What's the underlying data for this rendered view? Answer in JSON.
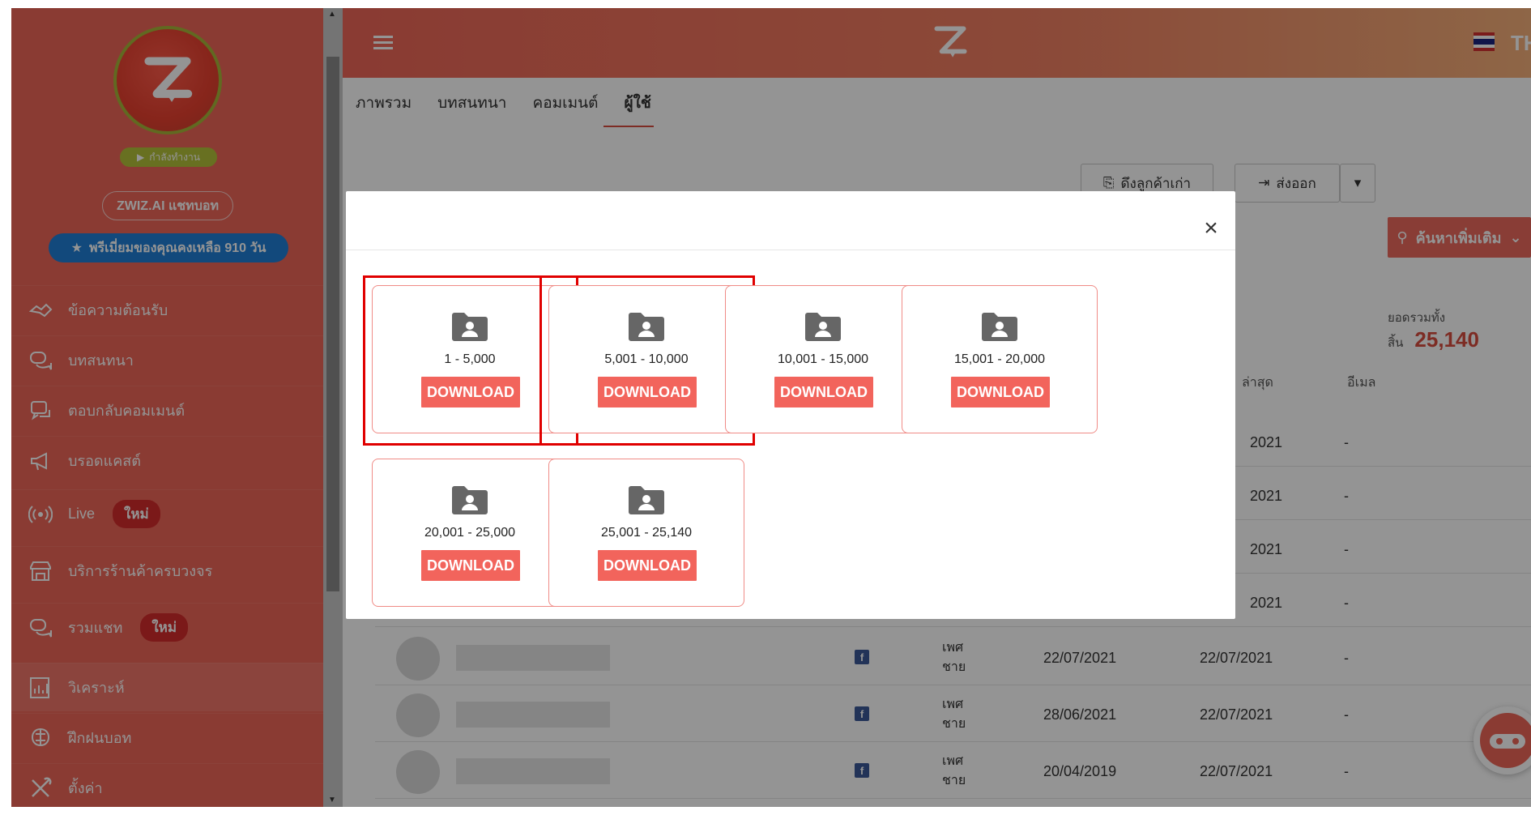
{
  "sidebar": {
    "status": "กำลังทำงาน",
    "bot_name": "ZWIZ.AI แชทบอท",
    "premium": "พรีเมี่ยมของคุณคงเหลือ 910 วัน",
    "items": [
      {
        "label": "ข้อความต้อนรับ",
        "icon": "handshake-icon",
        "badge": ""
      },
      {
        "label": "บทสนทนา",
        "icon": "chat-bubbles-icon",
        "badge": ""
      },
      {
        "label": "ตอบกลับคอมเมนต์",
        "icon": "comment-reply-icon",
        "badge": ""
      },
      {
        "label": "บรอดแคสต์",
        "icon": "megaphone-icon",
        "badge": ""
      },
      {
        "label": "Live",
        "icon": "live-broadcast-icon",
        "badge": "ใหม่"
      },
      {
        "label": "บริการร้านค้าครบวงจร",
        "icon": "store-icon",
        "badge": ""
      },
      {
        "label": "รวมแชท",
        "icon": "chat-bubbles-icon",
        "badge": "ใหม่"
      },
      {
        "label": "วิเคราะห์",
        "icon": "analytics-icon",
        "badge": ""
      },
      {
        "label": "ฝึกฝนบอท",
        "icon": "brain-training-icon",
        "badge": ""
      },
      {
        "label": "ตั้งค่า",
        "icon": "settings-tools-icon",
        "badge": ""
      }
    ]
  },
  "topbar": {
    "lang": "TH"
  },
  "tabs": [
    {
      "label": "ภาพรวม"
    },
    {
      "label": "บทสนทนา"
    },
    {
      "label": "คอมเมนต์"
    },
    {
      "label": "ผู้ใช้"
    }
  ],
  "toolbar": {
    "pull_old_customers": "ดึงลูกค้าเก่า",
    "export": "ส่งออก",
    "search_more": "ค้นหาเพิ่มเติม"
  },
  "summary": {
    "total_label": "ยอดรวมทั้งสิ้น",
    "total_value": "25,140"
  },
  "table": {
    "headers": {
      "last": "ล่าสุด",
      "email": "อีเมล"
    },
    "hidden_rows_year": [
      "2021",
      "2021",
      "2021",
      "2021"
    ],
    "rows": [
      {
        "gender_label": "เพศ",
        "gender": "ชาย",
        "first": "22/07/2021",
        "last": "22/07/2021",
        "email": "-"
      },
      {
        "gender_label": "เพศ",
        "gender": "ชาย",
        "first": "28/06/2021",
        "last": "22/07/2021",
        "email": "-"
      },
      {
        "gender_label": "เพศ",
        "gender": "ชาย",
        "first": "20/04/2019",
        "last": "22/07/2021",
        "email": "-"
      }
    ],
    "dash": "-"
  },
  "modal": {
    "close": "×",
    "cards": [
      {
        "range": "1 - 5,000",
        "button": "DOWNLOAD",
        "highlighted": true
      },
      {
        "range": "5,001 - 10,000",
        "button": "DOWNLOAD",
        "highlighted": true
      },
      {
        "range": "10,001 - 15,000",
        "button": "DOWNLOAD",
        "highlighted": false
      },
      {
        "range": "15,001 - 20,000",
        "button": "DOWNLOAD",
        "highlighted": false
      },
      {
        "range": "20,001 - 25,000",
        "button": "DOWNLOAD",
        "highlighted": false
      },
      {
        "range": "25,001 - 25,140",
        "button": "DOWNLOAD",
        "highlighted": false
      }
    ]
  },
  "colors": {
    "brand": "#ee6658",
    "download": "#f2645c",
    "highlight": "#e00000",
    "premium": "#1f7fd6"
  }
}
